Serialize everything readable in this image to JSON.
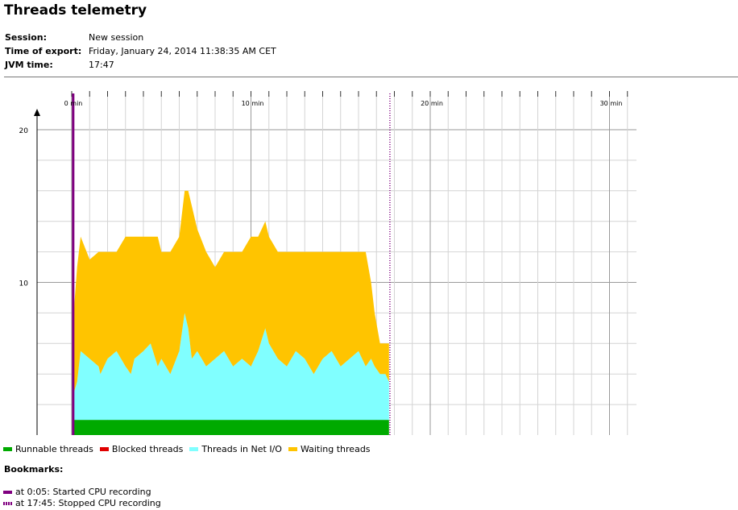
{
  "header": {
    "title": "Threads telemetry",
    "session_label": "Session:",
    "session_value": "New session",
    "export_label": "Time of export:",
    "export_value": "Friday, January 24, 2014 11:38:35 AM CET",
    "jvm_label": "JVM time:",
    "jvm_value": "17:47"
  },
  "legend": [
    {
      "label": "Runnable threads",
      "color": "#00aa00"
    },
    {
      "label": "Blocked threads",
      "color": "#e00000"
    },
    {
      "label": "Threads in Net I/O",
      "color": "#80ffff"
    },
    {
      "label": "Waiting threads",
      "color": "#ffc400"
    }
  ],
  "bookmarks": {
    "title": "Bookmarks:",
    "items": [
      {
        "text": "at 0:05: Started CPU recording",
        "color": "#800080",
        "style": "solid"
      },
      {
        "text": "at 17:45: Stopped CPU recording",
        "color": "#800080",
        "style": "dotted"
      }
    ]
  },
  "chart_data": {
    "type": "area",
    "stacked": true,
    "xlabel": "",
    "ylabel": "",
    "x_unit": "min",
    "xlim": [
      -0.1,
      31
    ],
    "ylim": [
      0,
      20
    ],
    "x_ticks": [
      0,
      10,
      20,
      30
    ],
    "x_tick_labels": [
      "0 min",
      "10 min",
      "20 min",
      "30 min"
    ],
    "y_ticks": [
      10,
      20
    ],
    "y_tick_labels": [
      "10",
      "20"
    ],
    "grid": true,
    "legend_position": "bottom",
    "bookmarks_min": [
      0.083,
      17.75
    ],
    "x": [
      0.05,
      0.3,
      0.5,
      1.0,
      1.5,
      1.6,
      2.0,
      2.5,
      3.0,
      3.3,
      3.5,
      4.0,
      4.4,
      4.8,
      5.0,
      5.5,
      6.0,
      6.3,
      6.5,
      6.7,
      7.0,
      7.5,
      8.0,
      8.5,
      9.0,
      9.5,
      10.0,
      10.4,
      10.8,
      11.0,
      11.5,
      12.0,
      12.5,
      13.0,
      13.5,
      14.0,
      14.5,
      15.0,
      15.5,
      16.0,
      16.4,
      16.7,
      16.9,
      17.2,
      17.5,
      17.7
    ],
    "series": [
      {
        "name": "Runnable threads",
        "values": [
          1,
          1,
          1,
          1,
          1,
          1,
          1,
          1,
          1,
          1,
          1,
          1,
          1,
          1,
          1,
          1,
          1,
          1,
          1,
          1,
          1,
          1,
          1,
          1,
          1,
          1,
          1,
          1,
          1,
          1,
          1,
          1,
          1,
          1,
          1,
          1,
          1,
          1,
          1,
          1,
          1,
          1,
          1,
          1,
          1,
          1
        ]
      },
      {
        "name": "Blocked threads",
        "values": [
          0,
          0,
          0,
          0,
          0,
          0,
          0,
          0,
          0,
          0,
          0,
          0,
          0,
          0,
          0,
          0,
          0,
          0,
          0,
          0,
          0,
          0,
          0,
          0,
          0,
          0,
          0,
          0,
          0,
          0,
          0,
          0,
          0,
          0,
          0,
          0,
          0,
          0,
          0,
          0,
          0,
          0,
          0,
          0,
          0,
          0
        ]
      },
      {
        "name": "Threads in Net I/O",
        "values": [
          1.5,
          2.5,
          4.5,
          4,
          3.5,
          3,
          4,
          4.5,
          3.5,
          3,
          4,
          4.5,
          5,
          3.5,
          4,
          3,
          4.5,
          7,
          6,
          4,
          4.5,
          3.5,
          4,
          4.5,
          3.5,
          4,
          3.5,
          4.5,
          6,
          5,
          4,
          3.5,
          4.5,
          4,
          3,
          4,
          4.5,
          3.5,
          4,
          4.5,
          3.5,
          4,
          3.5,
          3,
          3,
          2.5
        ]
      },
      {
        "name": "Waiting threads",
        "values": [
          4.5,
          7.5,
          7.5,
          6.5,
          7.5,
          8,
          7,
          6.5,
          8.5,
          9,
          8,
          7.5,
          7,
          8.5,
          7,
          8,
          7.5,
          8,
          9,
          10,
          8,
          7.5,
          6,
          6.5,
          7.5,
          7,
          8.5,
          7.5,
          7,
          7,
          7,
          7.5,
          6.5,
          7,
          8,
          7,
          6.5,
          7.5,
          7,
          6.5,
          7.5,
          5,
          3.5,
          2,
          2,
          2.5
        ]
      }
    ]
  }
}
